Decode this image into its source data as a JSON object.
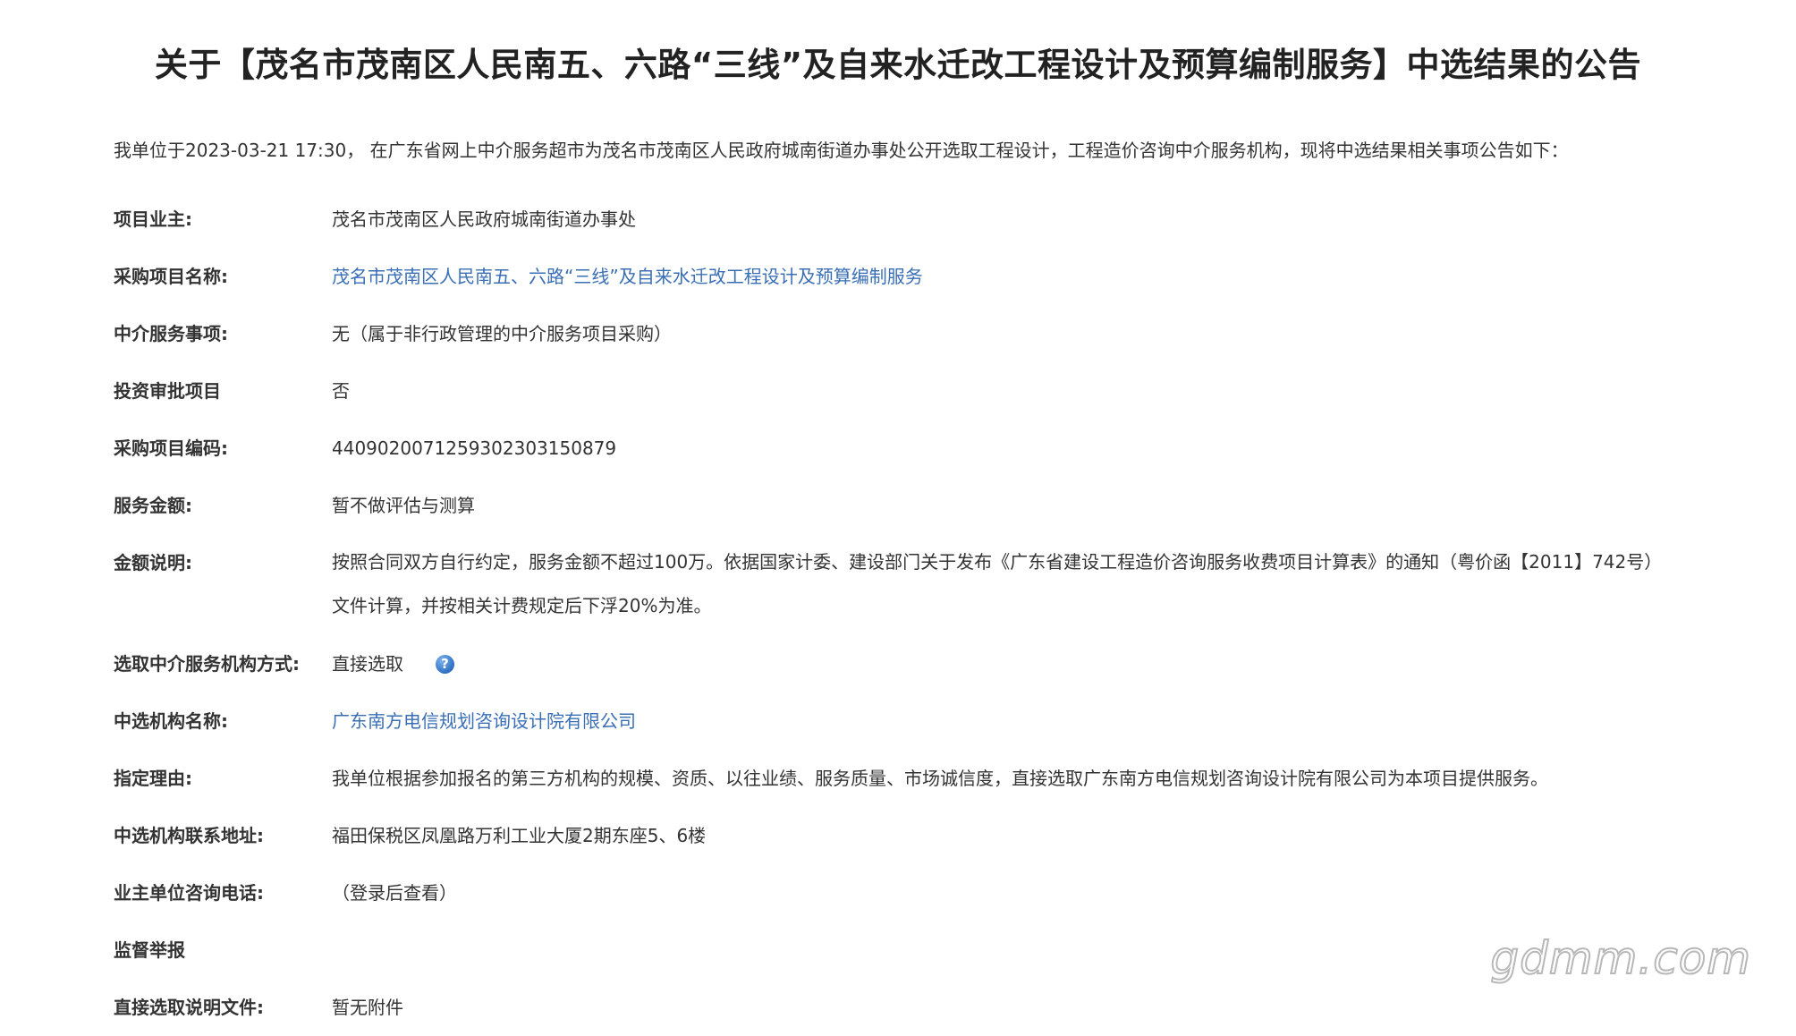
{
  "page": {
    "title": "关于【茂名市茂南区人民南五、六路“三线”及自来水迁改工程设计及预算编制服务】中选结果的公告",
    "intro": "我单位于2023-03-21 17:30， 在广东省网上中介服务超市为茂名市茂南区人民政府城南街道办事处公开选取工程设计，工程造价咨询中介服务机构，现将中选结果相关事项公告如下："
  },
  "fields": {
    "owner": {
      "label": "项目业主:",
      "value": "茂名市茂南区人民政府城南街道办事处"
    },
    "project_name": {
      "label": "采购项目名称:",
      "value": "茂名市茂南区人民南五、六路“三线”及自来水迁改工程设计及预算编制服务"
    },
    "service_item": {
      "label": "中介服务事项:",
      "value": "无（属于非行政管理的中介服务项目采购）"
    },
    "investment_approval": {
      "label": "投资审批项目",
      "value": "否"
    },
    "project_code": {
      "label": "采购项目编码:",
      "value": "4409020071259302303150879"
    },
    "amount": {
      "label": "服务金额:",
      "value": "暂不做评估与测算"
    },
    "amount_note": {
      "label": "金额说明:",
      "line1": "按照合同双方自行约定，服务金额不超过100万。依据国家计委、建设部门关于发布《广东省建设工程造价咨询服务收费项目计算表》的通知（粤价函【2011】742号）",
      "line2": "文件计算，并按相关计费规定后下浮20%为准。"
    },
    "selection_method": {
      "label": "选取中介服务机构方式:",
      "value": "直接选取",
      "help_icon": "question-help-icon"
    },
    "selected_org": {
      "label": "中选机构名称:",
      "value": "广东南方电信规划咨询设计院有限公司"
    },
    "reason": {
      "label": "指定理由:",
      "value": "我单位根据参加报名的第三方机构的规模、资质、以往业绩、服务质量、市场诚信度，直接选取广东南方电信规划咨询设计院有限公司为本项目提供服务。"
    },
    "org_address": {
      "label": "中选机构联系地址:",
      "value": "福田保税区凤凰路万利工业大厦2期东座5、6楼"
    },
    "owner_phone": {
      "label": "业主单位咨询电话:",
      "value": "（登录后查看）"
    },
    "supervision": {
      "label": "监督举报"
    },
    "attachment": {
      "label": "直接选取说明文件:",
      "value": "暂无附件"
    }
  },
  "watermark": "gdmm.com",
  "colors": {
    "link": "#3a6fb5",
    "text": "#333333",
    "title": "#222222"
  }
}
